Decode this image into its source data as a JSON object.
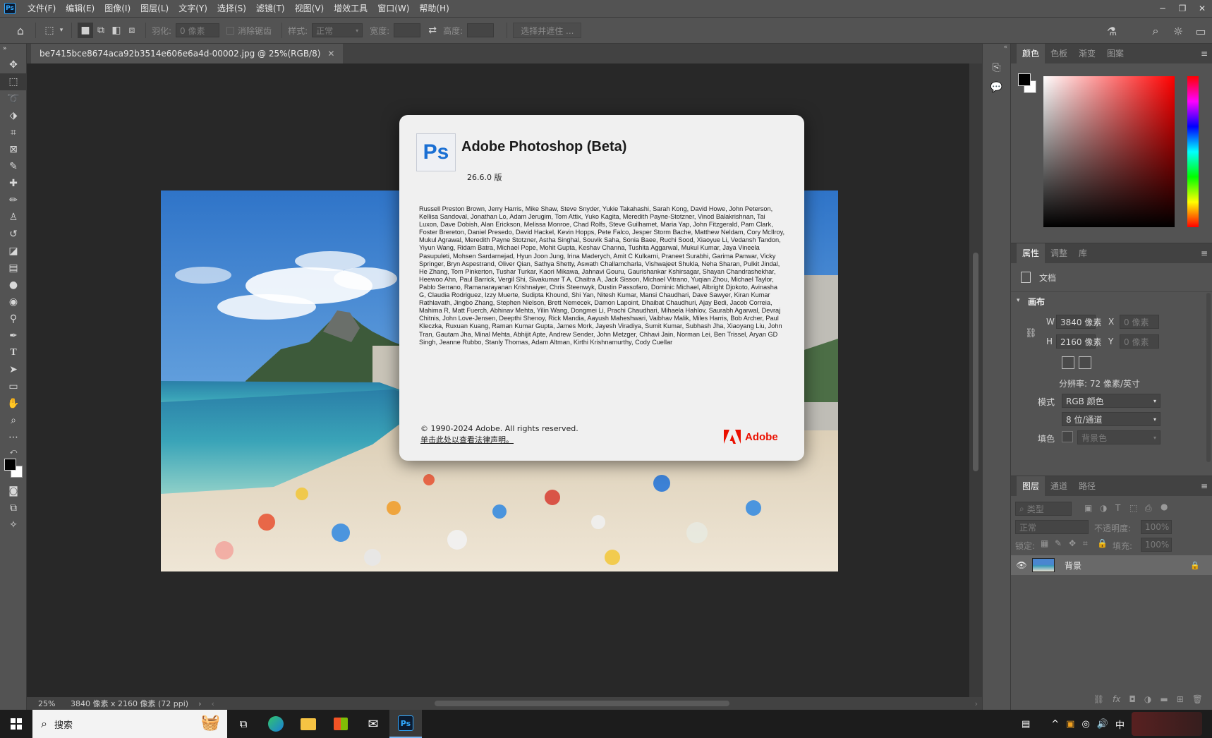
{
  "menubar": {
    "items": [
      "文件(F)",
      "编辑(E)",
      "图像(I)",
      "图层(L)",
      "文字(Y)",
      "选择(S)",
      "滤镜(T)",
      "视图(V)",
      "增效工具",
      "窗口(W)",
      "帮助(H)"
    ],
    "logo": "Ps"
  },
  "options": {
    "feather_label": "羽化:",
    "feather_value": "0 像素",
    "antialias_label": "消除锯齿",
    "style_label": "样式:",
    "style_value": "正常",
    "width_label": "宽度:",
    "height_label": "高度:",
    "select_mask_button": "选择并遮住 ..."
  },
  "document_tab": {
    "title": "be7415bce8674aca92b3514e606e6a4d-00002.jpg @ 25%(RGB/8)"
  },
  "status": {
    "zoom": "25%",
    "info": "3840 像素 x 2160 像素 (72 ppi)"
  },
  "color_panel": {
    "tabs": [
      "颜色",
      "色板",
      "渐变",
      "图案"
    ],
    "active_tab": "颜色",
    "hue_color": "#ff0000"
  },
  "properties_panel": {
    "tabs": [
      "属性",
      "调整",
      "库"
    ],
    "doc_label": "文档",
    "canvas_section": "画布",
    "w_label": "W",
    "w_value": "3840 像素",
    "h_label": "H",
    "h_value": "2160 像素",
    "x_label": "X",
    "x_placeholder": "0 像素",
    "y_label": "Y",
    "y_placeholder": "0 像素",
    "resolution": "分辨率: 72 像素/英寸",
    "mode_label": "模式",
    "mode_value": "RGB 颜色",
    "depth_value": "8 位/通道",
    "fill_label": "填色",
    "fill_value": "背景色"
  },
  "layers_panel": {
    "tabs": [
      "图层",
      "通道",
      "路径"
    ],
    "filter_placeholder": "类型",
    "blend_mode": "正常",
    "opacity_label": "不透明度:",
    "opacity_value": "100%",
    "lock_label": "锁定:",
    "fill_label": "填充:",
    "fill_value": "100%",
    "layers": [
      {
        "name": "背景"
      }
    ]
  },
  "about_dialog": {
    "logo_text": "Ps",
    "title": "Adobe Photoshop (Beta)",
    "version": "26.6.0 版",
    "credits": "Russell Preston Brown, Jerry Harris, Mike Shaw, Steve Snyder, Yukie Takahashi, Sarah Kong, David Howe, John Peterson, Kellisa Sandoval, Jonathan Lo, Adam Jerugim, Tom Attix, Yuko Kagita, Meredith Payne-Stotzner, Vinod Balakrishnan, Tai Luxon, Dave Dobish, Alan Erickson, Melissa Monroe, Chad Rolfs, Steve Guilhamet, Maria Yap, John Fitzgerald, Pam Clark, Foster Brereton, Daniel Presedo, David Hackel, Kevin Hopps, Pete Falco, Jesper Storm Bache, Matthew Neldam, Cory McIlroy, Mukul Agrawal, Meredith Payne Stotzner, Astha Singhal, Souvik Saha, Sonia Baee, Ruchi Sood, Xiaoyue Li, Vedansh Tandon, Yiyun Wang, Ridam Batra, Michael Pope, Mohit Gupta, Keshav Channa, Tushita Aggarwal, Mukul Kumar, Jaya Vineela Pasupuleti, Mohsen Sardarnejad, Hyun Joon Jung, Irina Maderych, Amit C Kulkarni, Praneet Surabhi, Garima Panwar, Vicky Springer, Bryn Aspestrand, Oliver Qian, Sathya Shetty, Aswath Challamcharla, Vishwajeet Shukla, Neha Sharan, Pulkit Jindal, He Zhang, Tom Pinkerton, Tushar Turkar, Kaori Mikawa, Jahnavi Gouru, Gaurishankar Kshirsagar, Shayan Chandrashekhar, Heewoo Ahn, Paul Barrick, Vergil Shi, Sivakumar T A, Chaitra A, Jack Sisson, Michael Vitrano, Yuqian Zhou, Michael Taylor, Pablo Serrano, Ramanarayanan Krishnaiyer, Chris Steenwyk, Dustin Passofaro, Dominic Michael, Albright Djokoto, Avinasha G, Claudia Rodriguez, Izzy Muerte, Sudipta Khound, Shi Yan, Nitesh Kumar, Mansi Chaudhari, Dave Sawyer, Kiran Kumar Rathlavath, Jingbo Zhang, Stephen Nielson, Brett Nemecek, Damon Lapoint, Dhaibat Chaudhuri, Ajay Bedi, Jacob Correia, Mahima R, Matt Fuerch, Abhinav Mehta, Yilin Wang, Dongmei Li, Prachi Chaudhari, Mihaela Hahlov, Saurabh Agarwal, Devraj Chitnis, John Love-Jensen, Deepthi Shenoy, Rick Mandia, Aayush Maheshwari, Vaibhav Malik, Miles Harris, Bob Archer, Paul Kleczka, Ruxuan Kuang, Raman Kumar Gupta, James Mork, Jayesh Viradiya, Sumit Kumar, Subhash Jha, Xiaoyang Liu, John Tran, Gautam Jha, Minal Mehta, Abhijit Apte, Andrew Sender, John Metzger, Chhavi Jain, Norman Lei, Ben Trissel, Aryan GD Singh, Jeanne Rubbo, Stanly Thomas, Adam Altman, Kirthi Krishnamurthy, Cody Cuellar",
    "copyright": "© 1990-2024 Adobe. All rights reserved.",
    "legal_link": "单击此处以查看法律声明。",
    "brand": "Adobe",
    "brand_color": "#eb1000"
  },
  "taskbar": {
    "search_placeholder": "搜索",
    "ime": "中",
    "ps_label": "Ps"
  }
}
